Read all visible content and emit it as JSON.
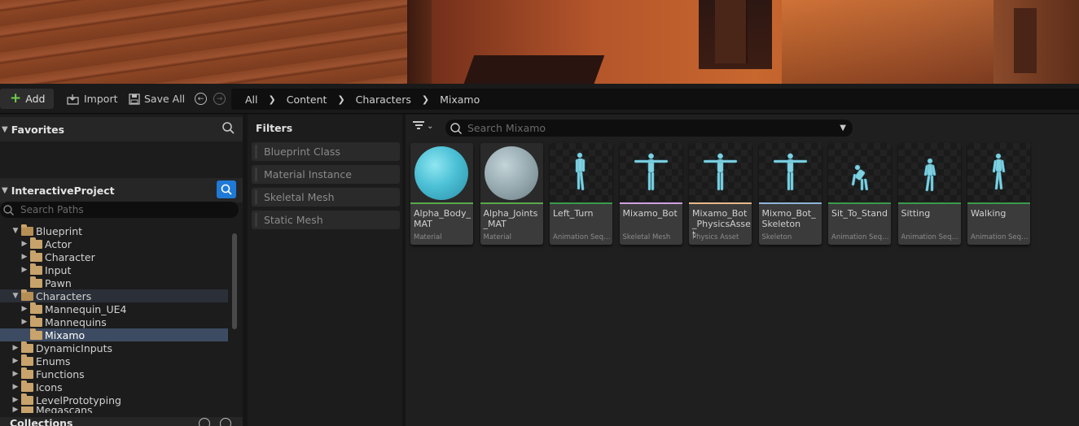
{
  "toolbar": {
    "add_label": "Add",
    "import_label": "Import",
    "save_all_label": "Save All"
  },
  "breadcrumb": [
    "All",
    "Content",
    "Characters",
    "Mixamo"
  ],
  "favorites": {
    "title": "Favorites"
  },
  "project": {
    "title": "InteractiveProject",
    "search_placeholder": "Search Paths"
  },
  "tree": [
    {
      "label": "Blueprint",
      "depth": 1,
      "open": true
    },
    {
      "label": "Actor",
      "depth": 2,
      "open": false
    },
    {
      "label": "Character",
      "depth": 2,
      "open": false
    },
    {
      "label": "Input",
      "depth": 2,
      "open": false
    },
    {
      "label": "Pawn",
      "depth": 2,
      "open": false,
      "leaf": true
    },
    {
      "label": "Characters",
      "depth": 1,
      "open": true
    },
    {
      "label": "Mannequin_UE4",
      "depth": 2,
      "open": false
    },
    {
      "label": "Mannequins",
      "depth": 2,
      "open": false
    },
    {
      "label": "Mixamo",
      "depth": 2,
      "open": false,
      "leaf": true,
      "selected": true
    },
    {
      "label": "DynamicInputs",
      "depth": 1,
      "open": false
    },
    {
      "label": "Enums",
      "depth": 1,
      "open": false
    },
    {
      "label": "Functions",
      "depth": 1,
      "open": false
    },
    {
      "label": "Icons",
      "depth": 1,
      "open": false
    },
    {
      "label": "LevelPrototyping",
      "depth": 1,
      "open": false
    },
    {
      "label": "Megascans",
      "depth": 1,
      "open": false
    }
  ],
  "collections": {
    "title": "Collections"
  },
  "filters": {
    "title": "Filters",
    "items": [
      "Blueprint Class",
      "Material Instance",
      "Skeletal Mesh",
      "Static Mesh"
    ]
  },
  "content": {
    "search_placeholder": "Search Mixamo",
    "assets": [
      {
        "name": "Alpha_Body_MAT",
        "type": "Material",
        "bar_color": "#59a84a",
        "thumb": "sphere-blue"
      },
      {
        "name": "Alpha_Joints_MAT",
        "type": "Material",
        "bar_color": "#59a84a",
        "thumb": "sphere-grey"
      },
      {
        "name": "Left_Turn",
        "type": "Animation Sequence",
        "bar_color": "#3a9a4a",
        "thumb": "figure-turn"
      },
      {
        "name": "Mixamo_Bot",
        "type": "Skeletal Mesh",
        "bar_color": "#d0a0e0",
        "thumb": "figure-tpose"
      },
      {
        "name": "Mixamo_Bot_PhysicsAsset",
        "type": "Physics Asset",
        "bar_color": "#e6b98a",
        "thumb": "figure-tpose"
      },
      {
        "name": "Mixmo_Bot_Skeleton",
        "type": "Skeleton",
        "bar_color": "#8fb4d8",
        "thumb": "figure-tpose"
      },
      {
        "name": "Sit_To_Stand",
        "type": "Animation Sequence",
        "bar_color": "#3a9a4a",
        "thumb": "figure-sit"
      },
      {
        "name": "Sitting",
        "type": "Animation Sequence",
        "bar_color": "#3a9a4a",
        "thumb": "figure-stand"
      },
      {
        "name": "Walking",
        "type": "Animation Sequence",
        "bar_color": "#3a9a4a",
        "thumb": "figure-walk"
      }
    ]
  },
  "colors": {
    "accent": "#1f7ad6",
    "selection": "#3c4b62",
    "folder": "#c8a36b"
  }
}
